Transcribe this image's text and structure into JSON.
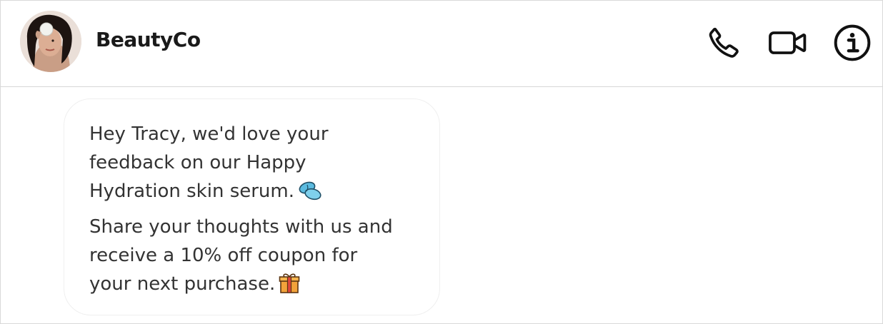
{
  "header": {
    "contact_name": "BeautyCo",
    "avatar": "profile-photo",
    "actions": [
      {
        "name": "phone-call",
        "icon": "phone-icon"
      },
      {
        "name": "video-call",
        "icon": "video-camera-icon"
      },
      {
        "name": "info",
        "icon": "info-icon"
      }
    ]
  },
  "message": {
    "paragraph_1": {
      "line_1": "Hey Tracy, we'd love your",
      "line_2": "feedback on our Happy",
      "line_3": "Hydration skin serum.",
      "emoji": "pill-capsule-icon"
    },
    "paragraph_2": {
      "line_1": "Share your thoughts with us and",
      "line_2": "receive a 10% off coupon for",
      "line_3": "your next purchase.",
      "emoji": "gift-icon"
    }
  },
  "colors": {
    "text": "#333333",
    "header_text": "#1a1a1a",
    "divider": "#d6d6d6",
    "bubble_border": "#efefef",
    "capsule": "#5bbbe0",
    "gift": "#f2a23a"
  }
}
